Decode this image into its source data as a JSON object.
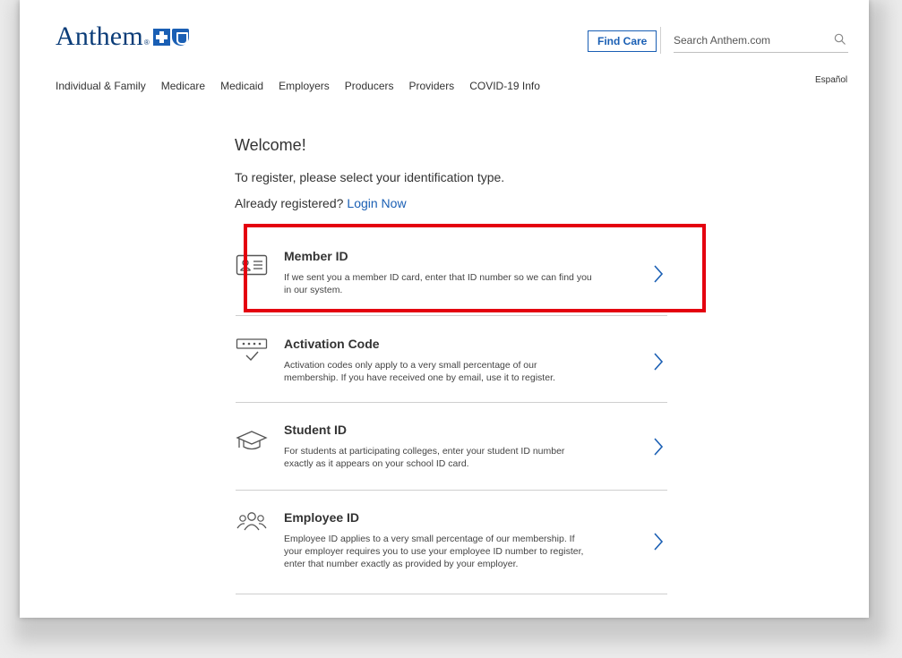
{
  "header": {
    "logo_text": "Anthem",
    "logo_reg": "®",
    "find_care_label": "Find Care",
    "search_placeholder": "Search Anthem.com",
    "espanol_label": "Español"
  },
  "nav": {
    "items": [
      "Individual & Family",
      "Medicare",
      "Medicaid",
      "Employers",
      "Producers",
      "Providers",
      "COVID-19 Info"
    ]
  },
  "main": {
    "welcome": "Welcome!",
    "instruction": "To register, please select your identification type.",
    "already_registered": "Already registered?",
    "login_link": "Login Now"
  },
  "options": [
    {
      "title": "Member ID",
      "desc_line1": "If we sent you a member ID card, enter that ID number so we can find you",
      "desc_line2": "in our system.",
      "icon": "id-card-icon",
      "highlighted": true
    },
    {
      "title": "Activation Code",
      "desc_line1": "Activation codes only apply to a very small percentage of our",
      "desc_line2": "membership. If you have received one by email, use it to register.",
      "icon": "activation-code-icon"
    },
    {
      "title": "Student ID",
      "desc_line1": "For students at participating colleges, enter your student ID number",
      "desc_line2": "exactly as it appears on your school ID card.",
      "icon": "graduation-cap-icon"
    },
    {
      "title": "Employee ID",
      "desc_line1": "Employee ID applies to a very small percentage of our membership. If",
      "desc_line2": "your employer requires you to use your employee ID number to register,",
      "desc_line3": "enter that number exactly as provided by your employer.",
      "icon": "people-group-icon"
    }
  ],
  "colors": {
    "brand_blue": "#1a5fb4",
    "logo_navy": "#0a3c78",
    "highlight_red": "#e4000f"
  }
}
